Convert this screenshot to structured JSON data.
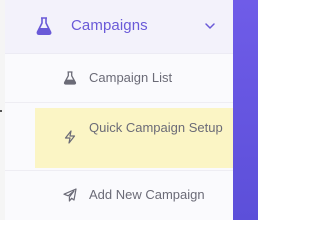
{
  "menu": {
    "header": {
      "label": "Campaigns",
      "icon": "flask-icon",
      "chevron": "chevron-down-icon"
    },
    "items": [
      {
        "label": "Campaign List",
        "icon": "flask-icon"
      },
      {
        "label": "Quick Campaign Setup",
        "icon": "bolt-icon",
        "highlighted": true
      },
      {
        "label": "Add New Campaign",
        "icon": "paper-plane-icon"
      }
    ]
  },
  "colors": {
    "accent": "#6a5ad8",
    "highlight": "#fbf5c5",
    "side_strip": "#6f5ce8"
  }
}
